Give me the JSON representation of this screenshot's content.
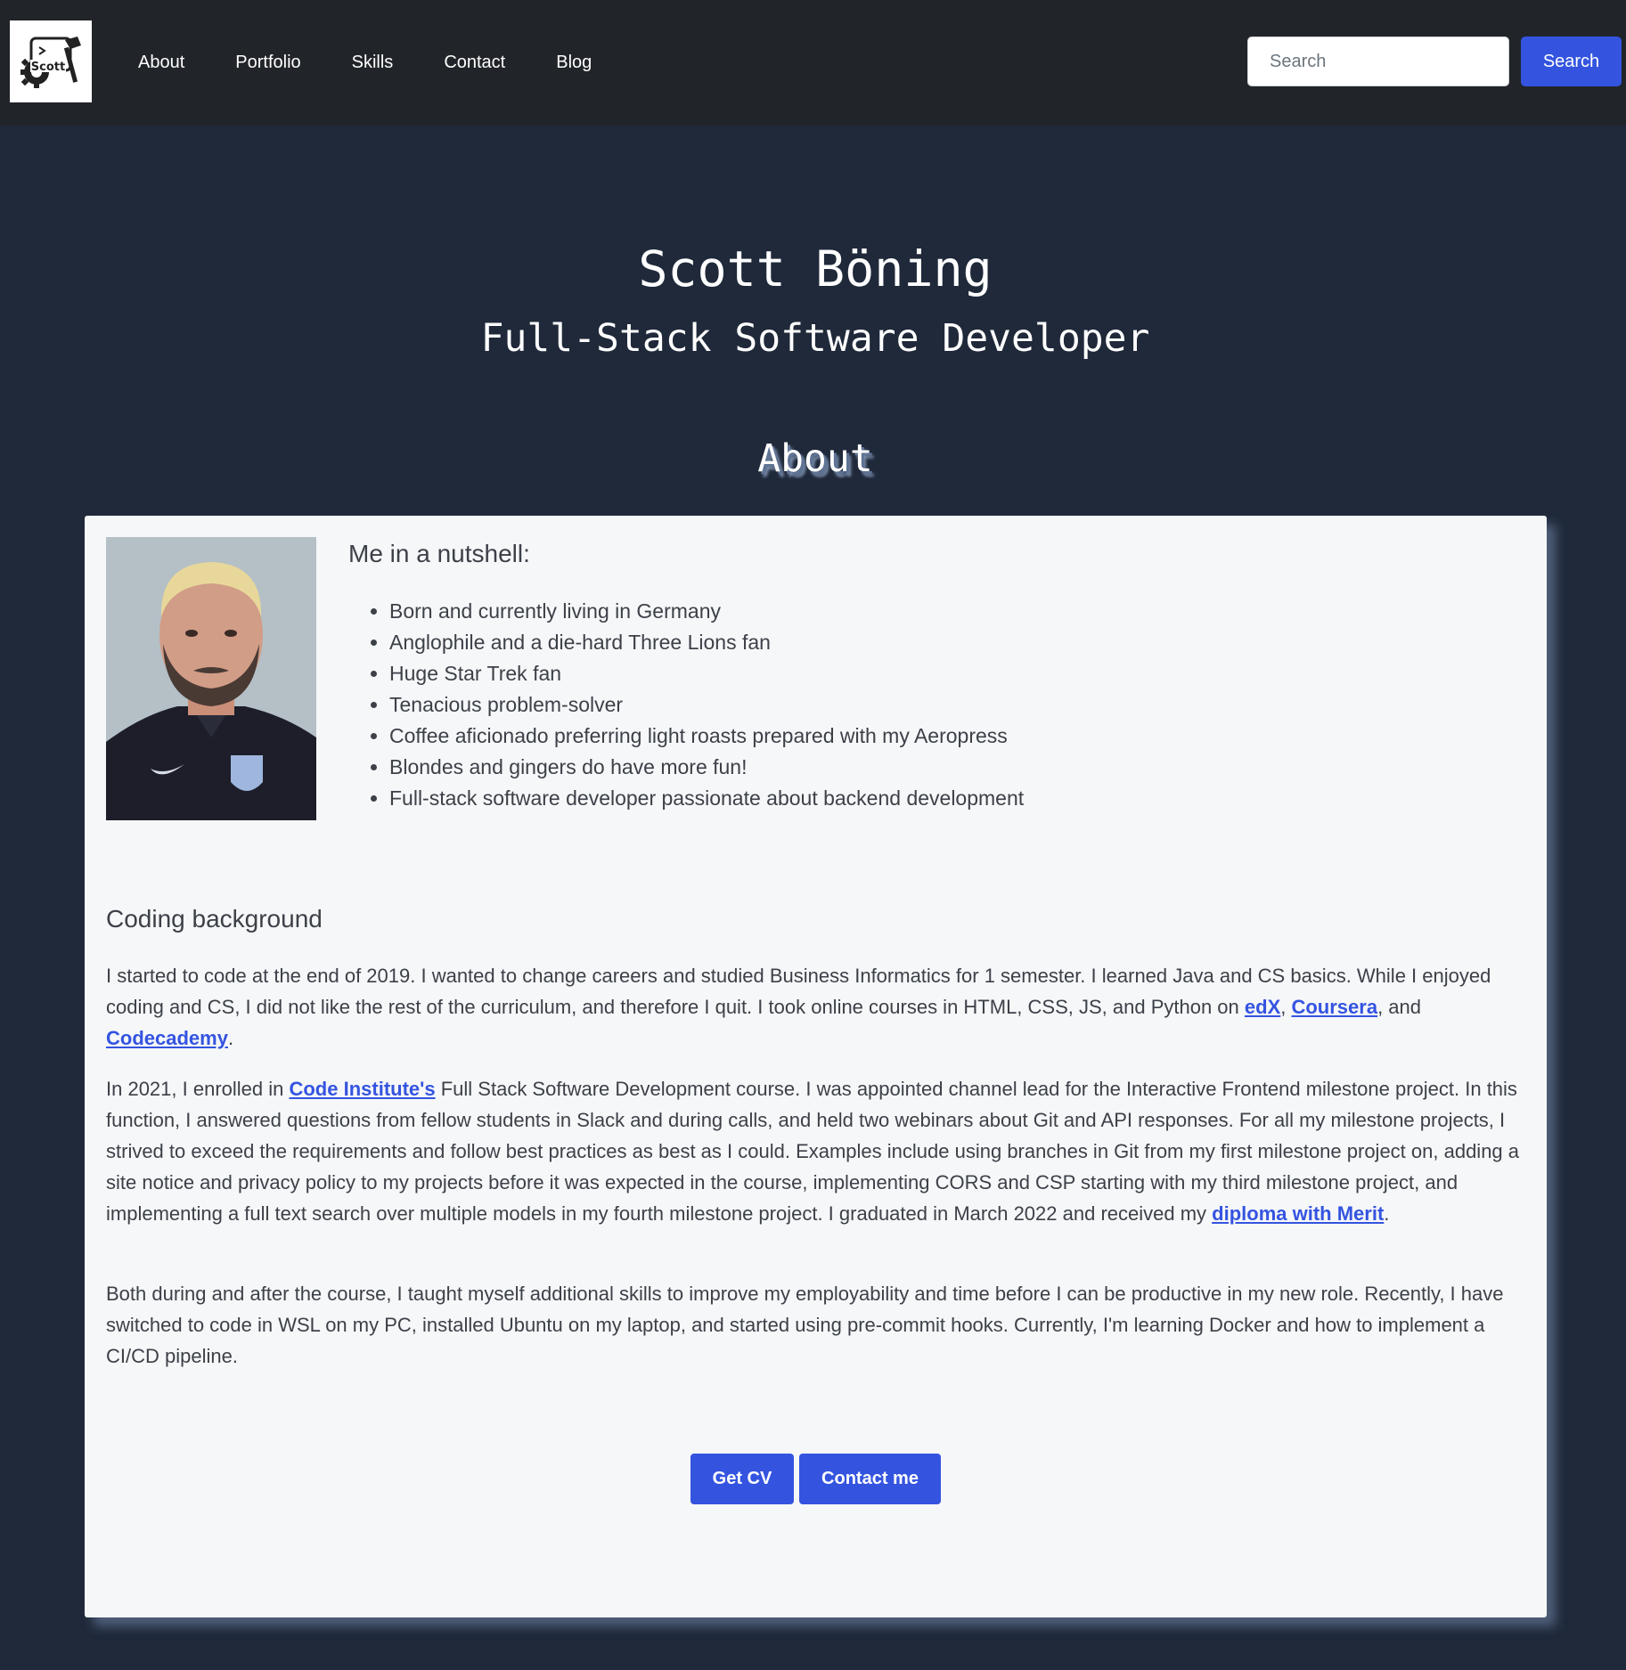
{
  "nav": {
    "logo_text": "Scott",
    "links": [
      "About",
      "Portfolio",
      "Skills",
      "Contact",
      "Blog"
    ],
    "search_placeholder": "Search",
    "search_button": "Search"
  },
  "hero": {
    "name": "Scott Böning",
    "title": "Full-Stack Software Developer"
  },
  "about": {
    "heading": "About",
    "nutshell_title": "Me in a nutshell:",
    "facts": [
      "Born and currently living in Germany",
      "Anglophile and a die-hard Three Lions fan",
      "Huge Star Trek fan",
      "Tenacious problem-solver",
      "Coffee aficionado preferring light roasts prepared with my Aeropress",
      "Blondes and gingers do have more fun!",
      "Full-stack software developer passionate about backend development"
    ],
    "background_title": "Coding background",
    "p1": {
      "text1": "I started to code at the end of 2019. I wanted to change careers and studied Business Informatics for 1 semester. I learned Java and CS basics. While I enjoyed coding and CS, I did not like the rest of the curriculum, and therefore I quit. I took online courses in HTML, CSS, JS, and Python on ",
      "link1": "edX",
      "sep1": ", ",
      "link2": "Coursera",
      "sep2": ", and ",
      "link3": "Codecademy",
      "end": "."
    },
    "p2": {
      "text1": "In 2021, I enrolled in ",
      "link1": "Code Institute's",
      "text2": " Full Stack Software Development course. I was appointed channel lead for the Interactive Frontend milestone project. In this function, I answered questions from fellow students in Slack and during calls, and held two webinars about Git and API responses. For all my milestone projects, I strived to exceed the requirements and follow best practices as best as I could. Examples include using branches in Git from my first milestone project on, adding a site notice and privacy policy to my projects before it was expected in the course, implementing CORS and CSP starting with my third milestone project, and implementing a full text search over multiple models in my fourth milestone project. I graduated in March 2022 and received my ",
      "link2": "diploma with Merit",
      "end": "."
    },
    "p3": "Both during and after the course, I taught myself additional skills to improve my employability and time before I can be productive in my new role. Recently, I have switched to code in WSL on my PC, installed Ubuntu on my laptop, and started using pre-commit hooks. Currently, I'm learning Docker and how to implement a CI/CD pipeline.",
    "buttons": {
      "cv": "Get CV",
      "contact": "Contact me"
    }
  },
  "colors": {
    "navbar": "#212529",
    "page_background": "#1f293a",
    "card": "#f6f7f9",
    "accent": "#3454e0"
  }
}
